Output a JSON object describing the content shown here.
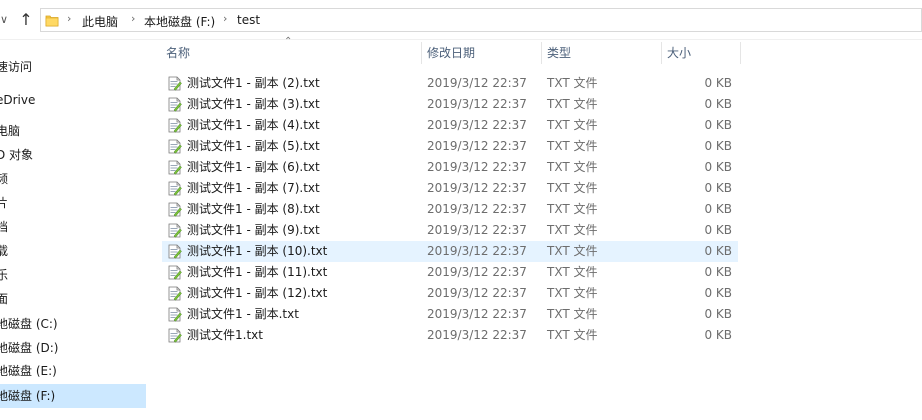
{
  "address_bar": {
    "crumbs": [
      "此电脑",
      "本地磁盘 (F:)",
      "test"
    ]
  },
  "sidebar": {
    "items": [
      {
        "label": "速访问",
        "selected": false
      },
      {
        "label": "eDrive",
        "selected": false
      },
      {
        "label": "电脑",
        "selected": false
      },
      {
        "label": "D 对象",
        "selected": false
      },
      {
        "label": "频",
        "selected": false
      },
      {
        "label": "片",
        "selected": false
      },
      {
        "label": "档",
        "selected": false
      },
      {
        "label": "载",
        "selected": false
      },
      {
        "label": "乐",
        "selected": false
      },
      {
        "label": "面",
        "selected": false
      },
      {
        "label": "地磁盘 (C:)",
        "selected": false
      },
      {
        "label": "地磁盘 (D:)",
        "selected": false
      },
      {
        "label": "地磁盘 (E:)",
        "selected": false
      },
      {
        "label": "地磁盘 (F:)",
        "selected": true
      }
    ]
  },
  "columns": {
    "name": "名称",
    "date": "修改日期",
    "type": "类型",
    "size": "大小"
  },
  "files": [
    {
      "name": "测试文件1 - 副本 (2).txt",
      "date": "2019/3/12 22:37",
      "type": "TXT 文件",
      "size": "0 KB"
    },
    {
      "name": "测试文件1 - 副本 (3).txt",
      "date": "2019/3/12 22:37",
      "type": "TXT 文件",
      "size": "0 KB"
    },
    {
      "name": "测试文件1 - 副本 (4).txt",
      "date": "2019/3/12 22:37",
      "type": "TXT 文件",
      "size": "0 KB"
    },
    {
      "name": "测试文件1 - 副本 (5).txt",
      "date": "2019/3/12 22:37",
      "type": "TXT 文件",
      "size": "0 KB"
    },
    {
      "name": "测试文件1 - 副本 (6).txt",
      "date": "2019/3/12 22:37",
      "type": "TXT 文件",
      "size": "0 KB"
    },
    {
      "name": "测试文件1 - 副本 (7).txt",
      "date": "2019/3/12 22:37",
      "type": "TXT 文件",
      "size": "0 KB"
    },
    {
      "name": "测试文件1 - 副本 (8).txt",
      "date": "2019/3/12 22:37",
      "type": "TXT 文件",
      "size": "0 KB"
    },
    {
      "name": "测试文件1 - 副本 (9).txt",
      "date": "2019/3/12 22:37",
      "type": "TXT 文件",
      "size": "0 KB"
    },
    {
      "name": "测试文件1 - 副本 (10).txt",
      "date": "2019/3/12 22:37",
      "type": "TXT 文件",
      "size": "0 KB"
    },
    {
      "name": "测试文件1 - 副本 (11).txt",
      "date": "2019/3/12 22:37",
      "type": "TXT 文件",
      "size": "0 KB"
    },
    {
      "name": "测试文件1 - 副本 (12).txt",
      "date": "2019/3/12 22:37",
      "type": "TXT 文件",
      "size": "0 KB"
    },
    {
      "name": "测试文件1 - 副本.txt",
      "date": "2019/3/12 22:37",
      "type": "TXT 文件",
      "size": "0 KB"
    },
    {
      "name": "测试文件1.txt",
      "date": "2019/3/12 22:37",
      "type": "TXT 文件",
      "size": "0 KB"
    }
  ],
  "hovered_row": 8,
  "icons": {
    "back_chevron": "chevron-down-icon",
    "up": "up-arrow-icon",
    "folder": "folder-icon",
    "file": "text-file-icon",
    "sort": "sort-ascending-icon"
  },
  "colors": {
    "selected_bg": "#cce8ff",
    "hover_bg": "#e5f3ff",
    "header_text": "#4c607a",
    "muted_text": "#6d6d6d"
  }
}
